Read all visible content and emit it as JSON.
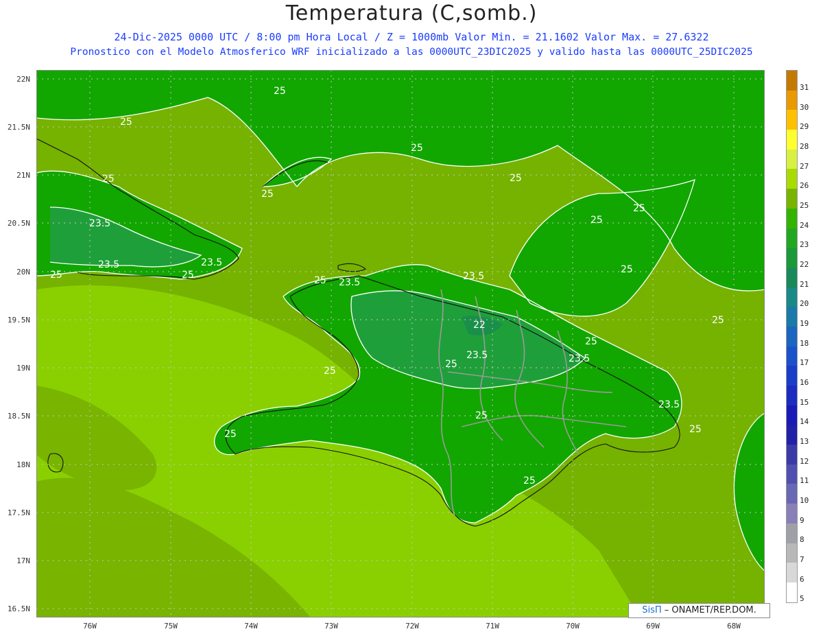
{
  "header": {
    "title": "Temperatura (C,somb.)",
    "line1": "24-Dic-2025  0000 UTC / 8:00 pm Hora Local / Z = 1000mb   Valor Min. = 21.1602  Valor Max. = 27.6322",
    "line2": "Pronostico con el Modelo Atmosferico WRF inicializado a las 0000UTC_23DIC2025 y valido hasta las  0000UTC_25DIC2025"
  },
  "axes": {
    "lat_labels": [
      "22N",
      "21.5N",
      "21N",
      "20.5N",
      "20N",
      "19.5N",
      "19N",
      "18.5N",
      "18N",
      "17.5N",
      "17N",
      "16.5N"
    ],
    "lon_labels": [
      "76W",
      "75W",
      "74W",
      "73W",
      "72W",
      "71W",
      "70W",
      "69W",
      "68W"
    ]
  },
  "contour_labels": [
    "25",
    "25",
    "25",
    "25",
    "25",
    "25",
    "25",
    "25",
    "25",
    "25",
    "25",
    "25",
    "25",
    "25",
    "25",
    "25",
    "25",
    "25",
    "25",
    "25",
    "23.5",
    "23.5",
    "23.5",
    "23.5",
    "23.5",
    "23.5",
    "23.5",
    "23.5",
    "22"
  ],
  "colorbar": {
    "labels": [
      "31",
      "30",
      "29",
      "28",
      "27",
      "26",
      "25",
      "24",
      "23",
      "22",
      "21",
      "20",
      "19",
      "18",
      "17",
      "16",
      "15",
      "14",
      "13",
      "12",
      "11",
      "10",
      "9",
      "8",
      "7",
      "6",
      "5"
    ],
    "colors": [
      "#c47a00",
      "#e89a00",
      "#ffc000",
      "#ffff30",
      "#d8f040",
      "#a8dc00",
      "#78b400",
      "#32b400",
      "#22a820",
      "#1a9a38",
      "#1a8a5a",
      "#198a88",
      "#1a7aa8",
      "#1a66c0",
      "#1a52cc",
      "#1a3ec8",
      "#1c2cc0",
      "#1a1ab8",
      "#2020a8",
      "#3a3aa8",
      "#5050b0",
      "#6868b4",
      "#8a80b8",
      "#a0a0a8",
      "#b8b8b8",
      "#d8d8d8",
      "#ffffff"
    ]
  },
  "credit": {
    "sis": "SisΠ",
    "text": " – ONAMET/REP.DOM."
  }
}
